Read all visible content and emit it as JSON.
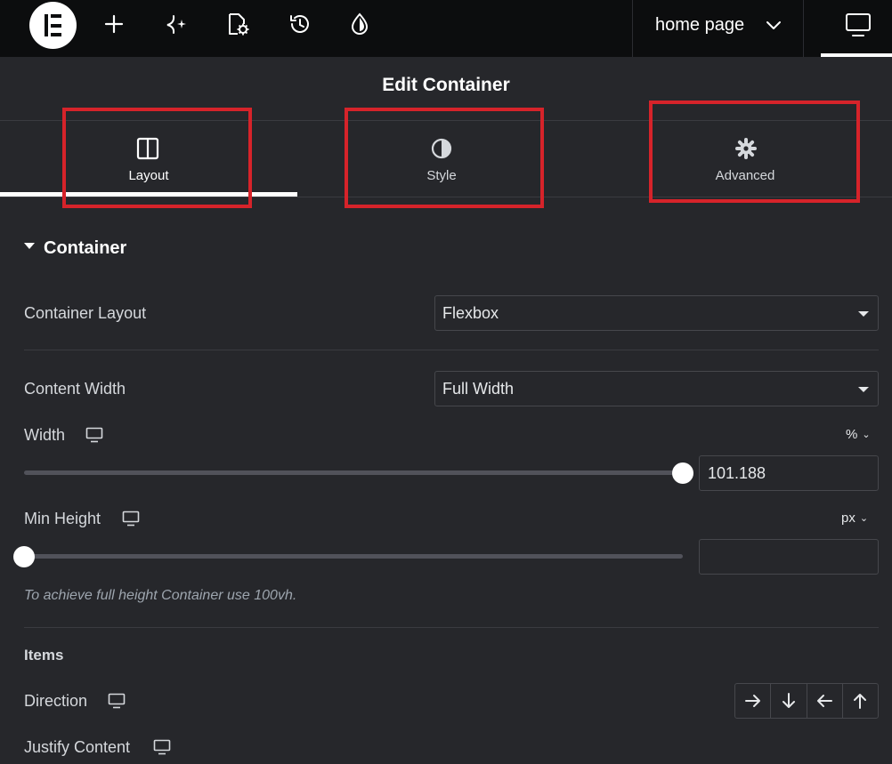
{
  "topbar": {
    "logo_name": "elementor-logo",
    "icons": [
      "add-icon",
      "ai-sparkle-icon",
      "page-settings-icon",
      "history-icon",
      "site-settings-icon"
    ],
    "document": {
      "label": "home page",
      "icon": "chevron-down-icon"
    },
    "responsive_icon": "desktop-icon"
  },
  "panel": {
    "title": "Edit Container",
    "tabs": [
      {
        "label": "Layout",
        "icon": "columns-icon",
        "active": true
      },
      {
        "label": "Style",
        "icon": "contrast-icon",
        "active": false
      },
      {
        "label": "Advanced",
        "icon": "gear-icon",
        "active": false
      }
    ],
    "highlight_color": "#d6232a"
  },
  "section": {
    "title": "Container",
    "container_layout": {
      "label": "Container Layout",
      "value": "Flexbox"
    },
    "content_width": {
      "label": "Content Width",
      "value": "Full Width"
    },
    "width": {
      "label": "Width",
      "unit": "%",
      "value": "101.188",
      "slider_fraction": 1.0
    },
    "min_height": {
      "label": "Min Height",
      "unit": "px",
      "value": "",
      "slider_fraction": 0.0
    },
    "hint": "To achieve full height Container use 100vh."
  },
  "items": {
    "heading": "Items",
    "direction": {
      "label": "Direction",
      "buttons": [
        "arrow-right-icon",
        "arrow-down-icon",
        "arrow-left-icon",
        "arrow-up-icon"
      ]
    },
    "justify_content": {
      "label": "Justify Content"
    }
  },
  "colors": {
    "background": "#26272b",
    "topbar": "#0c0d0e",
    "accent_white": "#ffffff"
  }
}
